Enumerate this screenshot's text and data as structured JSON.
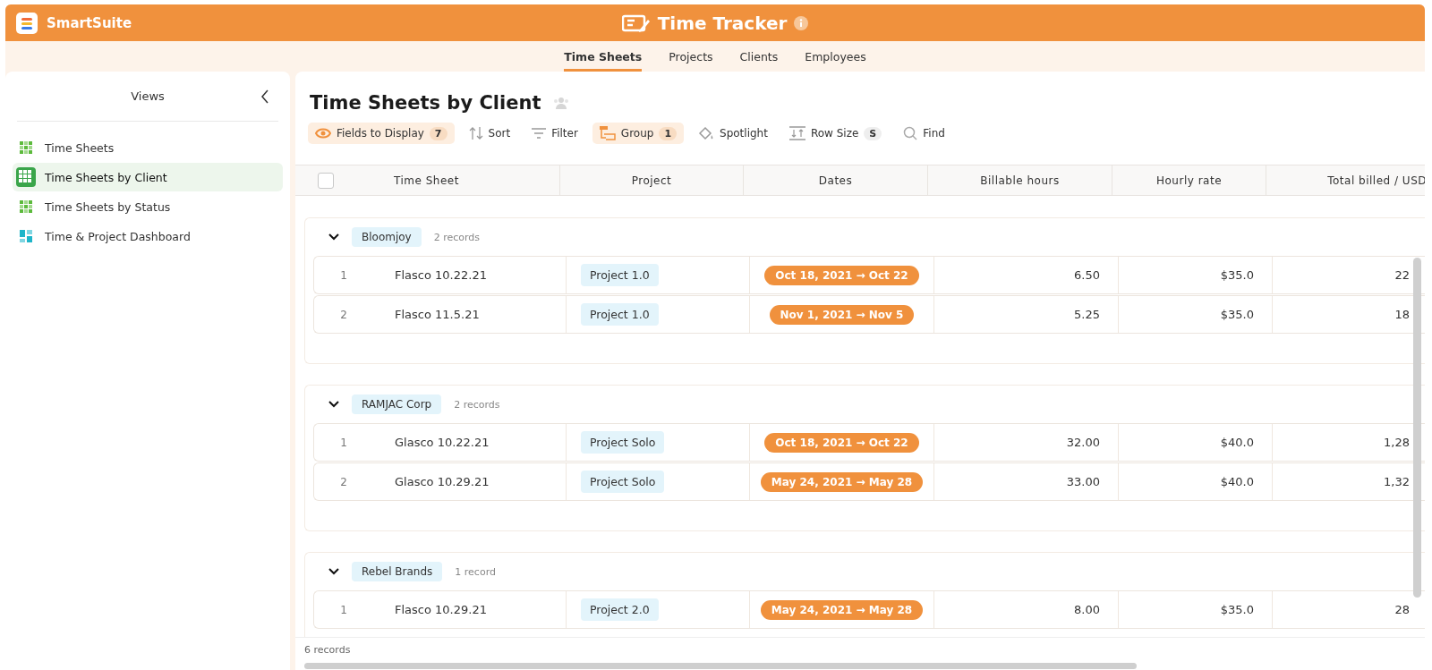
{
  "app": {
    "name": "SmartSuite"
  },
  "solution": {
    "title": "Time Tracker"
  },
  "tabs": [
    {
      "label": "Time Sheets",
      "selected": true
    },
    {
      "label": "Projects",
      "selected": false
    },
    {
      "label": "Clients",
      "selected": false
    },
    {
      "label": "Employees",
      "selected": false
    }
  ],
  "sidebar": {
    "title": "Views",
    "items": [
      {
        "label": "Time Sheets",
        "kind": "grid",
        "selected": false
      },
      {
        "label": "Time Sheets by Client",
        "kind": "grid",
        "selected": true
      },
      {
        "label": "Time Sheets by Status",
        "kind": "grid",
        "selected": false
      },
      {
        "label": "Time & Project Dashboard",
        "kind": "dashboard",
        "selected": false
      }
    ]
  },
  "view": {
    "title": "Time Sheets by Client"
  },
  "toolbar": [
    {
      "kind": "fields",
      "label": "Fields to Display",
      "count": "7",
      "active": true
    },
    {
      "kind": "sort",
      "label": "Sort",
      "active": false
    },
    {
      "kind": "filter",
      "label": "Filter",
      "active": false
    },
    {
      "kind": "group",
      "label": "Group",
      "count": "1",
      "active": true
    },
    {
      "kind": "spotlight",
      "label": "Spotlight",
      "active": false
    },
    {
      "kind": "rowsize",
      "label": "Row Size",
      "count": "S",
      "active": false
    },
    {
      "kind": "find",
      "label": "Find",
      "active": false
    }
  ],
  "table": {
    "select_all": {
      "checked": false
    },
    "columns": [
      "Time Sheet",
      "Project",
      "Dates",
      "Billable hours",
      "Hourly rate",
      "Total billed / USD"
    ],
    "groups": [
      {
        "name": "Bloomjoy",
        "count": "2 records",
        "expanded": true,
        "rows": [
          {
            "number": "1",
            "time_sheet": "Flasco 10.22.21",
            "project": "Project 1.0",
            "dates": "Oct 18, 2021 → Oct 22",
            "billable_hours": "6.50",
            "hourly_rate": "$35.0",
            "total": "22"
          },
          {
            "number": "2",
            "time_sheet": "Flasco 11.5.21",
            "project": "Project 1.0",
            "dates": "Nov 1, 2021 → Nov 5",
            "billable_hours": "5.25",
            "hourly_rate": "$35.0",
            "total": "18"
          }
        ]
      },
      {
        "name": "RAMJAC Corp",
        "count": "2 records",
        "expanded": true,
        "rows": [
          {
            "number": "1",
            "time_sheet": "Glasco 10.22.21",
            "project": "Project Solo",
            "dates": "Oct 18, 2021 → Oct 22",
            "billable_hours": "32.00",
            "hourly_rate": "$40.0",
            "total": "1,28"
          },
          {
            "number": "2",
            "time_sheet": "Glasco 10.29.21",
            "project": "Project Solo",
            "dates": "May 24, 2021 → May 28",
            "billable_hours": "33.00",
            "hourly_rate": "$40.0",
            "total": "1,32"
          }
        ]
      },
      {
        "name": "Rebel Brands",
        "count": "1 record",
        "expanded": true,
        "rows": [
          {
            "number": "1",
            "time_sheet": "Flasco 10.29.21",
            "project": "Project 2.0",
            "dates": "May 24, 2021 → May 28",
            "billable_hours": "8.00",
            "hourly_rate": "$35.0",
            "total": "28"
          }
        ]
      }
    ]
  },
  "footer": {
    "record_count": "6 records"
  }
}
